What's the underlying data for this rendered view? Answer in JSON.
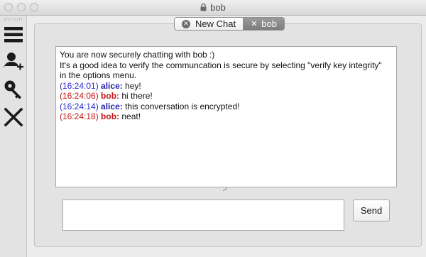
{
  "window": {
    "title": "bob"
  },
  "sidebar": {
    "icons": [
      "menu-icon",
      "add-contact-icon",
      "key-icon",
      "close-icon"
    ]
  },
  "tabs": [
    {
      "label": "New Chat",
      "icon": "close-circle-icon"
    },
    {
      "label": "bob",
      "icon": "close-icon",
      "active": true
    }
  ],
  "chat": {
    "intro_1": "You are now securely chatting with bob :)",
    "intro_2": "It's a good idea to verify the communcation is secure by selecting \"verify key integrity\"",
    "intro_3": "in the options menu.",
    "messages": [
      {
        "time": "(16:24:01)",
        "sender": "alice:",
        "text": " hey!"
      },
      {
        "time": "(16:24:06)",
        "sender": "bob:",
        "text": " hi there!"
      },
      {
        "time": "(16:24:14)",
        "sender": "alice:",
        "text": " this conversation is encrypted!"
      },
      {
        "time": "(16:24:18)",
        "sender": "bob:",
        "text": " neat!"
      }
    ]
  },
  "composer": {
    "value": "",
    "send_label": "Send"
  },
  "colors": {
    "alice": "#2020b0",
    "bob": "#c41818"
  }
}
